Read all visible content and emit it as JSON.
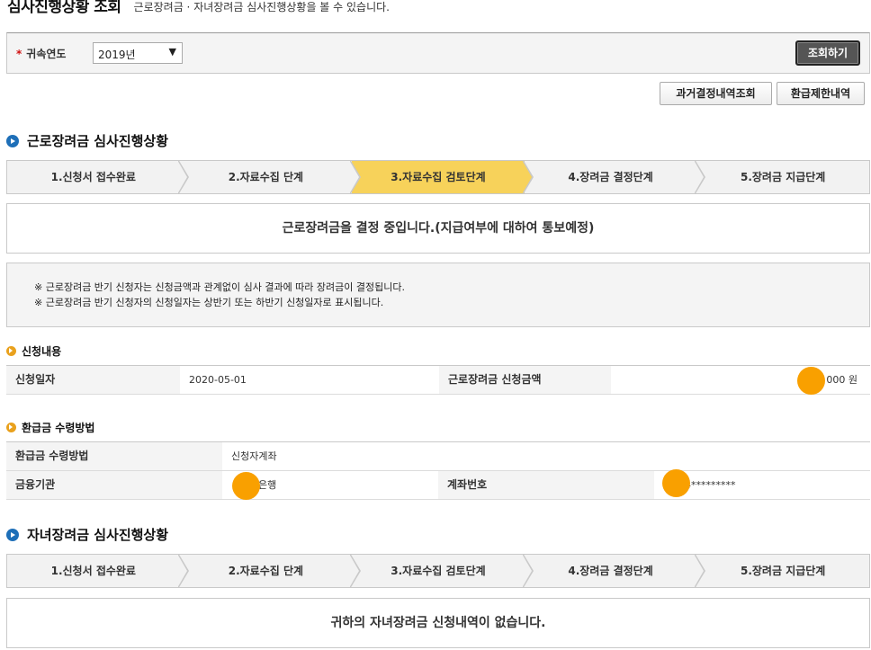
{
  "header": {
    "title": "심사진행상황 조회",
    "description": "근로장려금 · 자녀장려금 심사진행상황을 볼 수 있습니다."
  },
  "search": {
    "required_mark": "*",
    "year_label": "귀속연도",
    "year_value": "2019년",
    "search_button": "조회하기"
  },
  "actions": {
    "past_decisions": "과거결정내역조회",
    "refund_limit": "환급제한내역"
  },
  "earned_credit": {
    "section_title": "근로장려금 심사진행상황",
    "steps": [
      {
        "label": "1.신청서 접수완료",
        "active": false
      },
      {
        "label": "2.자료수집 단계",
        "active": false
      },
      {
        "label": "3.자료수집 검토단계",
        "active": true
      },
      {
        "label": "4.장려금 결정단계",
        "active": false
      },
      {
        "label": "5.장려금 지급단계",
        "active": false
      }
    ],
    "status_message": "근로장려금을 결정 중입니다.(지급여부에 대하여 통보예정)",
    "notices": [
      "※ 근로장려금 반기 신청자는 신청금액과 관계없이 심사 결과에 따라 장려금이 결정됩니다.",
      "※ 근로장려금 반기 신청자의 신청일자는 상반기 또는 하반기 신청일자로 표시됩니다."
    ]
  },
  "application": {
    "title": "신청내용",
    "date_label": "신청일자",
    "date_value": "2020-05-01",
    "amount_label": "근로장려금 신청금액",
    "amount_value": "000 원"
  },
  "refund": {
    "title": "환급금 수령방법",
    "method_label": "환급금 수령방법",
    "method_value": "신청자계좌",
    "bank_label": "금융기관",
    "bank_value": "은행",
    "account_label": "계좌번호",
    "account_value": "4*********"
  },
  "child_credit": {
    "section_title": "자녀장려금 심사진행상황",
    "steps": [
      {
        "label": "1.신청서 접수완료",
        "active": false
      },
      {
        "label": "2.자료수집 단계",
        "active": false
      },
      {
        "label": "3.자료수집 검토단계",
        "active": false
      },
      {
        "label": "4.장려금 결정단계",
        "active": false
      },
      {
        "label": "5.장려금 지급단계",
        "active": false
      }
    ],
    "status_message": "귀하의 자녀장려금 신청내역이 없습니다."
  },
  "colors": {
    "active_step": "#f7d25a",
    "section_bullet": "#1e6fb8",
    "sub_bullet": "#e9a11d",
    "redaction_dot": "#f9a000"
  }
}
